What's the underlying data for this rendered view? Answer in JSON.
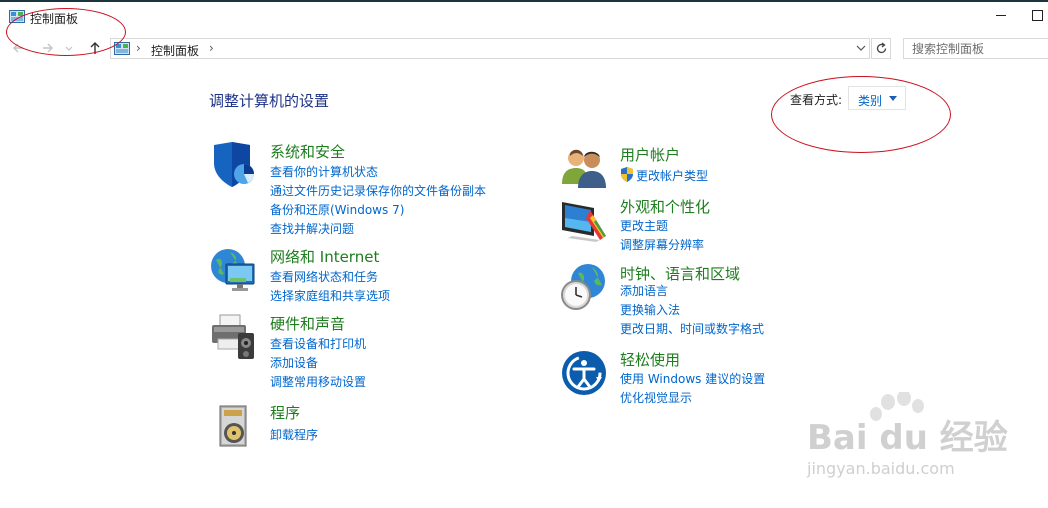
{
  "window": {
    "title": "控制面板"
  },
  "address": {
    "path": "控制面板",
    "separator": "›"
  },
  "search": {
    "placeholder": "搜索控制面板"
  },
  "page": {
    "title": "调整计算机的设置",
    "view_label": "查看方式:",
    "view_value": "类别"
  },
  "categories_left": [
    {
      "title": "系统和安全",
      "icon": "shield-icon",
      "links": [
        "查看你的计算机状态",
        "通过文件历史记录保存你的文件备份副本",
        "备份和还原(Windows 7)",
        "查找并解决问题"
      ]
    },
    {
      "title": "网络和 Internet",
      "icon": "network-globe-icon",
      "links": [
        "查看网络状态和任务",
        "选择家庭组和共享选项"
      ]
    },
    {
      "title": "硬件和声音",
      "icon": "printer-speaker-icon",
      "links": [
        "查看设备和打印机",
        "添加设备",
        "调整常用移动设置"
      ]
    },
    {
      "title": "程序",
      "icon": "programs-disc-icon",
      "links": [
        "卸载程序"
      ]
    }
  ],
  "categories_right": [
    {
      "title": "用户帐户",
      "icon": "users-icon",
      "links": [
        "更改帐户类型"
      ]
    },
    {
      "title": "外观和个性化",
      "icon": "display-palette-icon",
      "links": [
        "更改主题",
        "调整屏幕分辨率"
      ]
    },
    {
      "title": "时钟、语言和区域",
      "icon": "clock-globe-icon",
      "links": [
        "添加语言",
        "更换输入法",
        "更改日期、时间或数字格式"
      ]
    },
    {
      "title": "轻松使用",
      "icon": "ease-of-access-icon",
      "links": [
        "使用 Windows 建议的设置",
        "优化视觉显示"
      ]
    }
  ],
  "watermark": {
    "logo": "Bai du 经验",
    "url": "jingyan.baidu.com"
  },
  "colors": {
    "category_title": "#1e7d1e",
    "link": "#0066cc",
    "page_title": "#1e3287",
    "annotation": "#c8101e"
  }
}
